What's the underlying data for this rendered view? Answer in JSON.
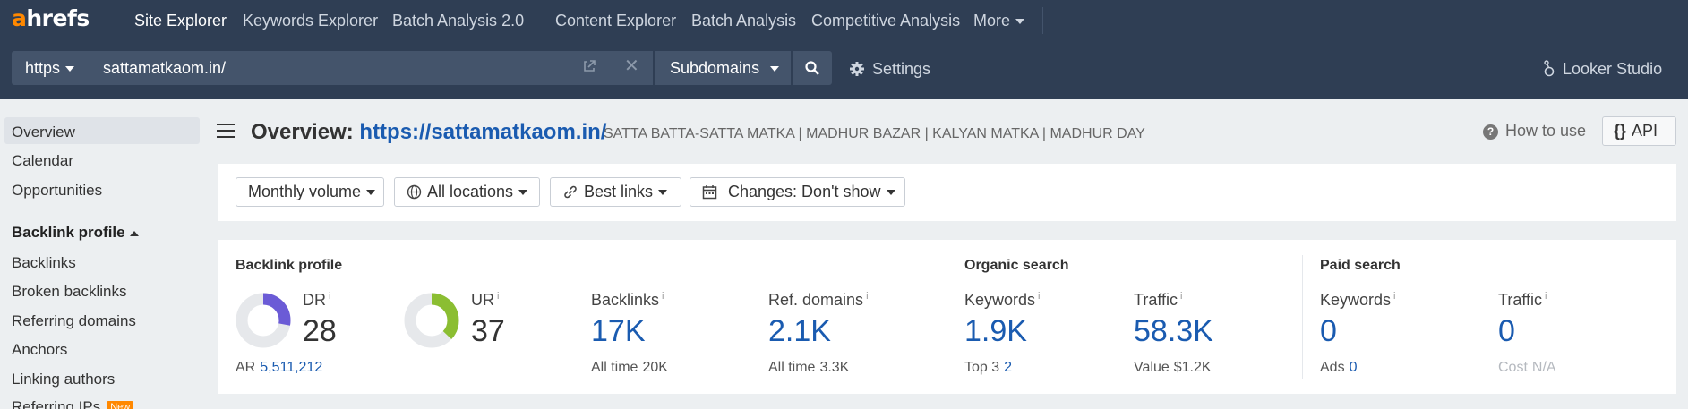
{
  "colors": {
    "nav_bg": "#2f3e54",
    "brand_orange": "#ff8800",
    "link_blue": "#1a5bb0",
    "dr_purple": "#6b5bd6",
    "ur_green": "#8bbe32"
  },
  "topnav": {
    "logo_a": "a",
    "logo_rest": "hrefs",
    "items": [
      {
        "label": "Site Explorer",
        "active": true
      },
      {
        "label": "Keywords Explorer"
      },
      {
        "label": "Batch Analysis 2.0"
      },
      {
        "label": "Content Explorer"
      },
      {
        "label": "Batch Analysis"
      },
      {
        "label": "Competitive Analysis"
      },
      {
        "label": "More"
      }
    ]
  },
  "search": {
    "protocol": "https",
    "url": "sattamatkaom.in/",
    "mode": "Subdomains",
    "settings_label": "Settings",
    "looker_label": "Looker Studio"
  },
  "sidebar": {
    "items": [
      "Overview",
      "Calendar",
      "Opportunities"
    ],
    "section": "Backlink profile",
    "section_items": [
      "Backlinks",
      "Broken backlinks",
      "Referring domains",
      "Anchors",
      "Linking authors",
      "Referring IPs"
    ],
    "new_badge": "New"
  },
  "header": {
    "title_prefix": "Overview:",
    "title_url": "https://sattamatkaom.in/",
    "subtitle": "SATTA BATTA-SATTA MATKA | MADHUR BAZAR | KALYAN MATKA | MADHUR DAY",
    "how_to_use": "How to use",
    "api_label": "API"
  },
  "filters": {
    "volume": "Monthly volume",
    "locations": "All locations",
    "links": "Best links",
    "changes": "Changes: Don't show"
  },
  "metrics": {
    "backlink_title": "Backlink profile",
    "organic_title": "Organic search",
    "paid_title": "Paid search",
    "info": "i",
    "dr": {
      "label": "DR",
      "value": "28",
      "fraction": 0.28,
      "sub_label": "AR",
      "sub_value": "5,511,212"
    },
    "ur": {
      "label": "UR",
      "value": "37",
      "fraction": 0.37
    },
    "backlinks": {
      "label": "Backlinks",
      "value": "17K",
      "sub_label": "All time",
      "sub_value": "20K"
    },
    "ref_domains": {
      "label": "Ref. domains",
      "value": "2.1K",
      "sub_label": "All time",
      "sub_value": "3.3K"
    },
    "org_keywords": {
      "label": "Keywords",
      "value": "1.9K",
      "sub_label": "Top 3",
      "sub_value": "2"
    },
    "org_traffic": {
      "label": "Traffic",
      "value": "58.3K",
      "sub_label": "Value",
      "sub_value": "$1.2K"
    },
    "paid_keywords": {
      "label": "Keywords",
      "value": "0",
      "sub_label": "Ads",
      "sub_value": "0"
    },
    "paid_traffic": {
      "label": "Traffic",
      "value": "0",
      "sub_label": "Cost",
      "sub_value": "N/A"
    }
  }
}
